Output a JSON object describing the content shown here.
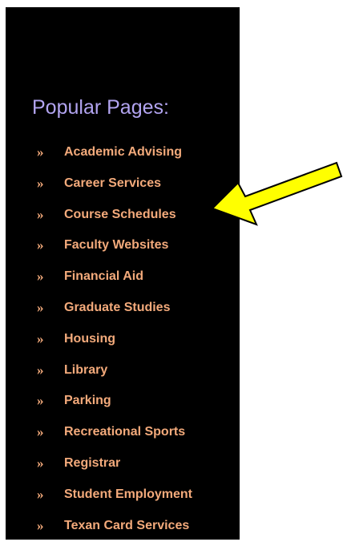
{
  "sidebar": {
    "title": "Popular Pages:",
    "bullet_glyph": "»",
    "links": [
      {
        "label": "Academic Advising"
      },
      {
        "label": "Career Services"
      },
      {
        "label": "Course Schedules"
      },
      {
        "label": "Faculty Websites"
      },
      {
        "label": "Financial Aid"
      },
      {
        "label": "Graduate Studies"
      },
      {
        "label": "Housing"
      },
      {
        "label": "Library"
      },
      {
        "label": "Parking"
      },
      {
        "label": "Recreational Sports"
      },
      {
        "label": "Registrar"
      },
      {
        "label": "Student Employment"
      },
      {
        "label": "Texan Card Services"
      }
    ]
  },
  "annotation": {
    "arrow_color": "#ffff00",
    "arrow_outline_color": "#000000",
    "points_to": "Course Schedules"
  },
  "colors": {
    "panel_background": "#000000",
    "title_color": "#b2a4f0",
    "link_color": "#f3aa7b",
    "page_background": "#ffffff"
  }
}
